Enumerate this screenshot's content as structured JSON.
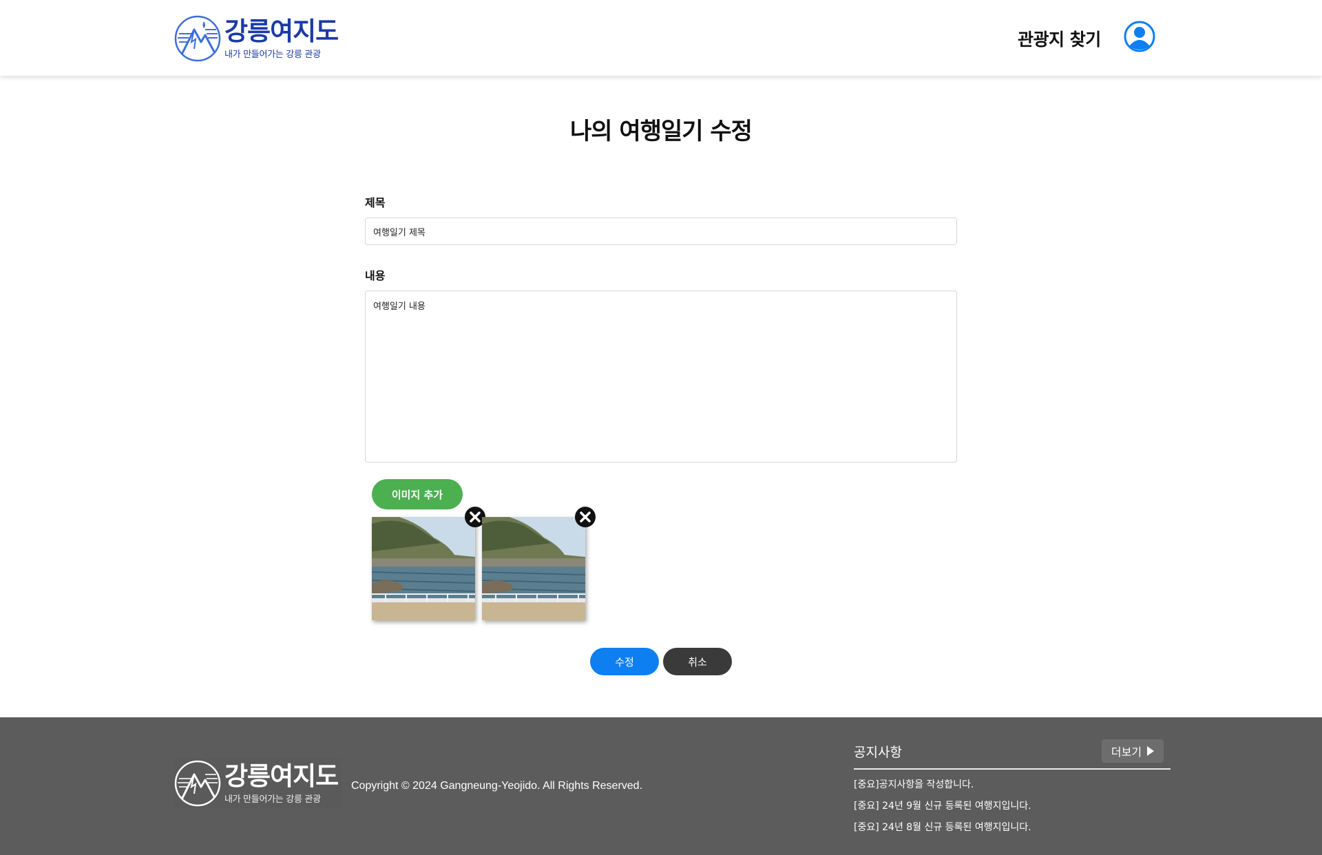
{
  "header": {
    "logo_title": "강릉여지도",
    "logo_subtitle": "내가 만들어가는 강릉 관광",
    "nav_find": "관광지 찾기",
    "user_icon": "user-circle-icon",
    "accent_color": "#1b3aa8"
  },
  "main": {
    "page_title": "나의 여행일기 수정",
    "title_label": "제목",
    "title_value": "여행일기 제목",
    "content_label": "내용",
    "content_value": "여행일기 내용",
    "add_image_label": "이미지 추가",
    "images": [
      {
        "alt": "coastal-photo",
        "remove_icon": "close-circle-icon"
      },
      {
        "alt": "coastal-photo",
        "remove_icon": "close-circle-icon"
      }
    ],
    "submit_label": "수정",
    "cancel_label": "취소",
    "colors": {
      "add": "#4caf50",
      "submit": "#0d7ff0",
      "cancel": "#3a3a3a"
    }
  },
  "footer": {
    "logo_title": "강릉여지도",
    "logo_subtitle": "내가 만들어가는 강릉 관광",
    "copyright": "Copyright © 2024 Gangneung-Yeojido. All Rights Reserved.",
    "notice_title": "공지사항",
    "more_label": "더보기",
    "notices": [
      "[중요]공지사항을 작성합니다.",
      "[중요] 24년 9월 신규 등록된 여행지입니다.",
      "[중요] 24년 8월 신규 등록된 여행지입니다."
    ]
  }
}
